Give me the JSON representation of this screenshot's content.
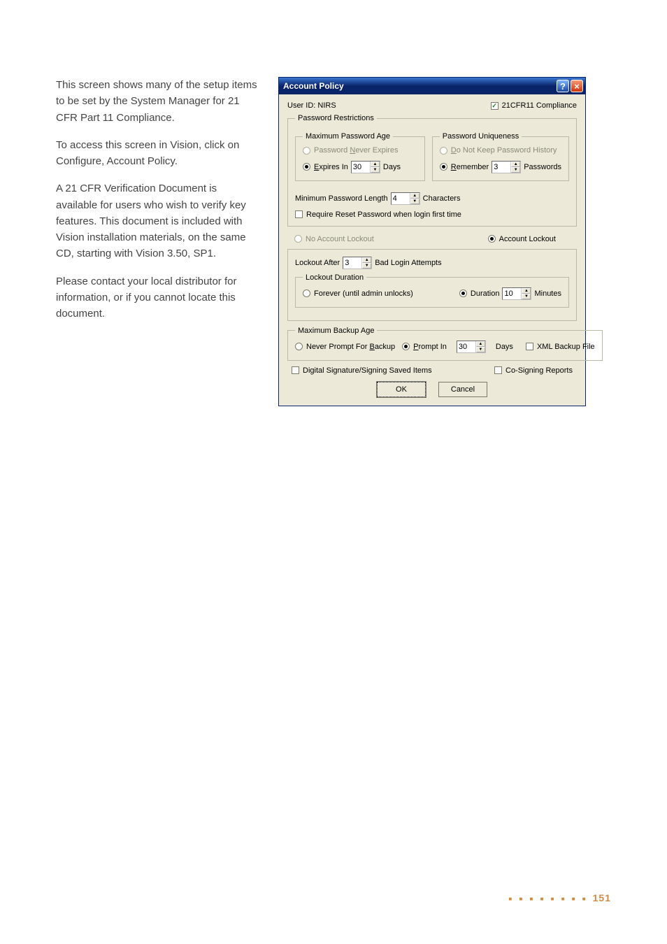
{
  "left_text": {
    "p1": "This screen shows many of the setup items to be set by the System Manager for 21 CFR Part 11 Compliance.",
    "p2": "To access this screen in Vision, click on Configure, Account Policy.",
    "p3": "A 21 CFR Verification Document is available for users who wish to verify key features. This document is included with Vision installation materials, on the same CD, starting with Vision 3.50, SP1.",
    "p4": "Please contact your local distributor for information, or if you cannot locate this document."
  },
  "dialog": {
    "title": "Account Policy",
    "help_glyph": "?",
    "close_glyph": "×",
    "user_id_label": "User ID:  NIRS",
    "compliance_label": "21CFR11 Compliance",
    "groups": {
      "pw_restrictions": "Password Restrictions",
      "max_pw_age": "Maximum Password Age",
      "pw_uniqueness": "Password Uniqueness",
      "lockout_duration": "Lockout Duration",
      "max_backup_age": "Maximum Backup Age"
    },
    "max_age": {
      "never_prefix": "Password ",
      "never_u": "N",
      "never_suffix": "ever Expires",
      "expires_u": "E",
      "expires_suffix": "xpires In",
      "expires_value": "30",
      "expires_unit": "Days"
    },
    "uniqueness": {
      "nohist_u": "D",
      "nohist_suffix": "o Not Keep Password History",
      "remember_u": "R",
      "remember_suffix": "emember",
      "remember_value": "3",
      "remember_unit": "Passwords"
    },
    "min_len": {
      "label": "Minimum Password Length",
      "value": "4",
      "unit": "Characters"
    },
    "require_reset_label": "Require Reset Password when login first time",
    "lockout_mode": {
      "no_lockout": "No Account Lockout",
      "account_lockout": "Account Lockout"
    },
    "lockout_after": {
      "label": "Lockout After",
      "value": "3",
      "unit": "Bad Login Attempts"
    },
    "lockout_duration": {
      "forever": "Forever (until admin unlocks)",
      "duration_label": "Duration",
      "duration_value": "10",
      "duration_unit": "Minutes"
    },
    "backup": {
      "never_prefix": "Never Prompt For ",
      "never_u": "B",
      "never_suffix": "ackup",
      "prompt_u": "P",
      "prompt_suffix": "rompt In",
      "prompt_value": "30",
      "prompt_unit": "Days",
      "xml_label": "XML Backup File"
    },
    "dsig_label": "Digital Signature/Signing Saved Items",
    "cosign_label": "Co-Signing Reports",
    "ok_label": "OK",
    "cancel_label": "Cancel"
  },
  "footer": {
    "dots": "■ ■ ■ ■ ■ ■ ■ ■",
    "page": "151"
  }
}
